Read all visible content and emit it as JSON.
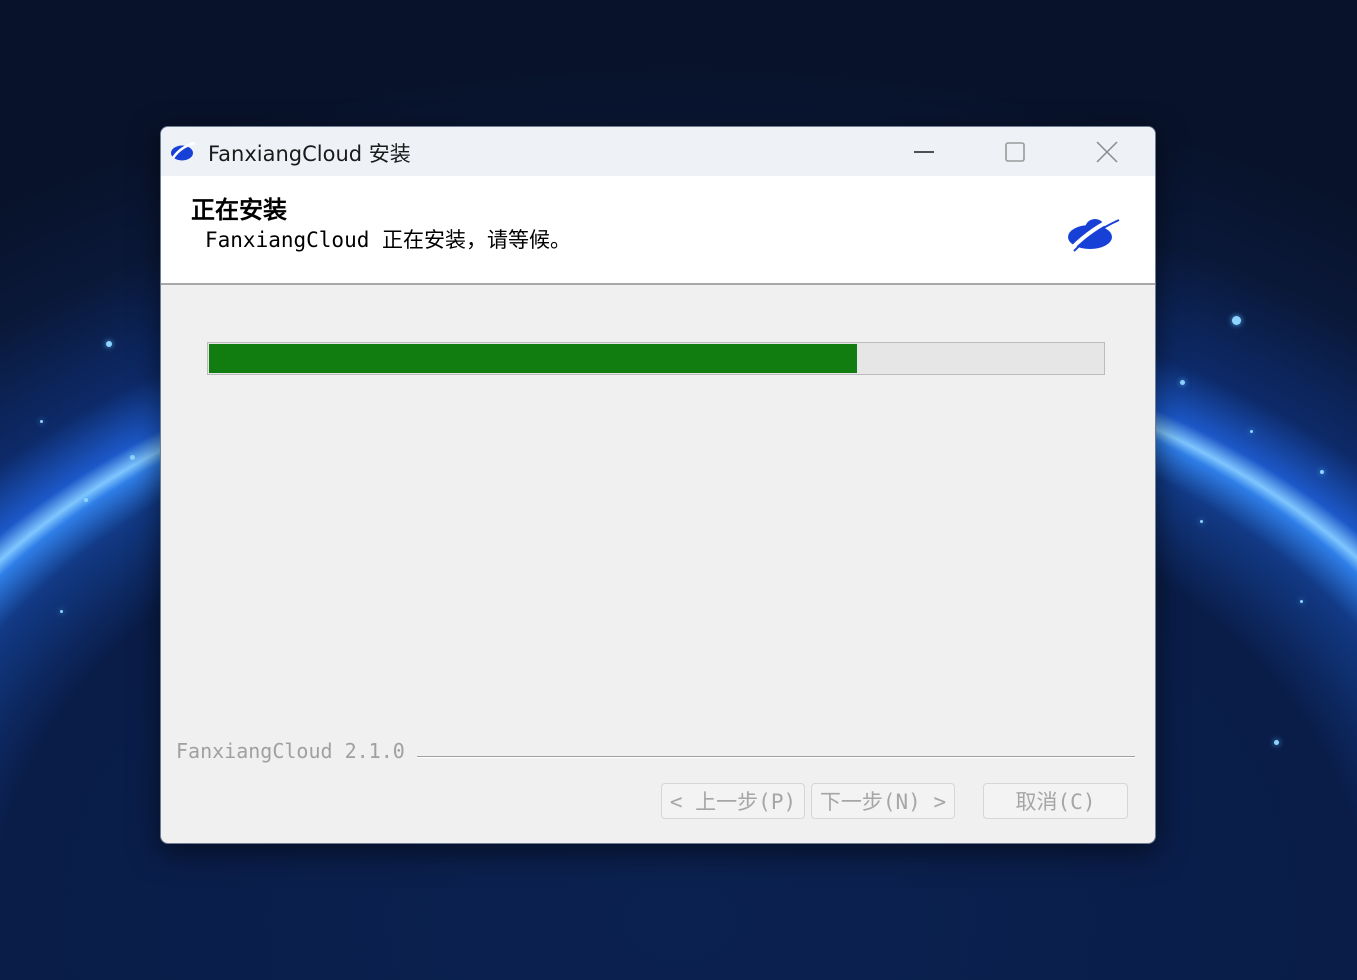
{
  "window": {
    "title": "FanxiangCloud 安装",
    "controls": {
      "minimize_icon": "minimize-icon",
      "maximize_icon": "maximize-icon",
      "close_icon": "close-icon"
    }
  },
  "header": {
    "title": "正在安装",
    "subtitle": "FanxiangCloud 正在安装，请等候。",
    "logo_icon": "fanxiangcloud-logo-icon"
  },
  "progress": {
    "value": 0.725,
    "fill_color": "#117d10"
  },
  "footer": {
    "version": "FanxiangCloud 2.1.0",
    "back_label": "< 上一步(P)",
    "next_label": "下一步(N) >",
    "cancel_label": "取消(C)"
  },
  "colors": {
    "brand": "#1740d6",
    "progress": "#117d10",
    "disabled_text": "#a6a6a6"
  }
}
